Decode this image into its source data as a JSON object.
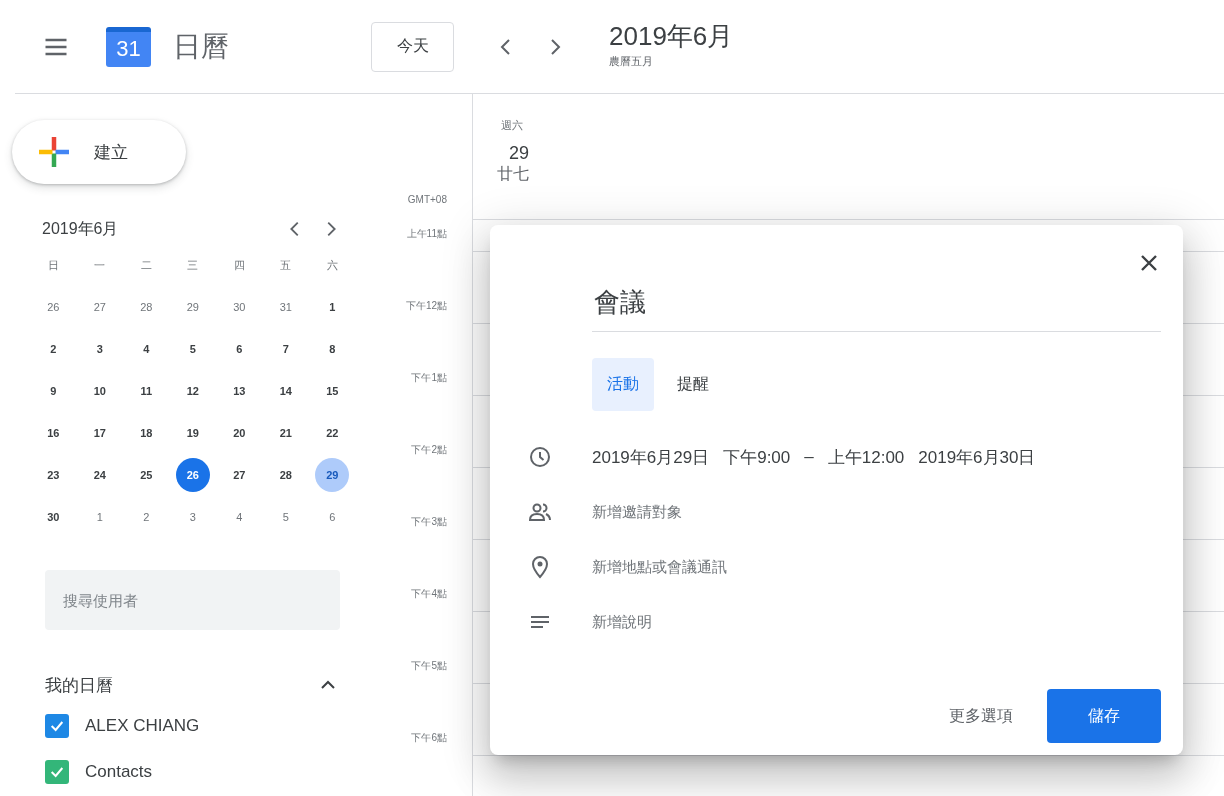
{
  "header": {
    "app_name": "日曆",
    "logo_day": "31",
    "today_button": "今天",
    "title": "2019年6月",
    "subtitle": "農曆五月"
  },
  "sidebar": {
    "create_button": "建立",
    "mini_calendar": {
      "title": "2019年6月",
      "weekdays": [
        "日",
        "一",
        "二",
        "三",
        "四",
        "五",
        "六"
      ],
      "weeks": [
        {
          "days": [
            {
              "day": "26",
              "in_month": false,
              "today": false,
              "selected": false
            },
            {
              "day": "27",
              "in_month": false,
              "today": false,
              "selected": false
            },
            {
              "day": "28",
              "in_month": false,
              "today": false,
              "selected": false
            },
            {
              "day": "29",
              "in_month": false,
              "today": false,
              "selected": false
            },
            {
              "day": "30",
              "in_month": false,
              "today": false,
              "selected": false
            },
            {
              "day": "31",
              "in_month": false,
              "today": false,
              "selected": false
            },
            {
              "day": "1",
              "in_month": true,
              "today": false,
              "selected": false
            }
          ]
        },
        {
          "days": [
            {
              "day": "2",
              "in_month": true,
              "today": false,
              "selected": false
            },
            {
              "day": "3",
              "in_month": true,
              "today": false,
              "selected": false
            },
            {
              "day": "4",
              "in_month": true,
              "today": false,
              "selected": false
            },
            {
              "day": "5",
              "in_month": true,
              "today": false,
              "selected": false
            },
            {
              "day": "6",
              "in_month": true,
              "today": false,
              "selected": false
            },
            {
              "day": "7",
              "in_month": true,
              "today": false,
              "selected": false
            },
            {
              "day": "8",
              "in_month": true,
              "today": false,
              "selected": false
            }
          ]
        },
        {
          "days": [
            {
              "day": "9",
              "in_month": true,
              "today": false,
              "selected": false
            },
            {
              "day": "10",
              "in_month": true,
              "today": false,
              "selected": false
            },
            {
              "day": "11",
              "in_month": true,
              "today": false,
              "selected": false
            },
            {
              "day": "12",
              "in_month": true,
              "today": false,
              "selected": false
            },
            {
              "day": "13",
              "in_month": true,
              "today": false,
              "selected": false
            },
            {
              "day": "14",
              "in_month": true,
              "today": false,
              "selected": false
            },
            {
              "day": "15",
              "in_month": true,
              "today": false,
              "selected": false
            }
          ]
        },
        {
          "days": [
            {
              "day": "16",
              "in_month": true,
              "today": false,
              "selected": false
            },
            {
              "day": "17",
              "in_month": true,
              "today": false,
              "selected": false
            },
            {
              "day": "18",
              "in_month": true,
              "today": false,
              "selected": false
            },
            {
              "day": "19",
              "in_month": true,
              "today": false,
              "selected": false
            },
            {
              "day": "20",
              "in_month": true,
              "today": false,
              "selected": false
            },
            {
              "day": "21",
              "in_month": true,
              "today": false,
              "selected": false
            },
            {
              "day": "22",
              "in_month": true,
              "today": false,
              "selected": false
            }
          ]
        },
        {
          "days": [
            {
              "day": "23",
              "in_month": true,
              "today": false,
              "selected": false
            },
            {
              "day": "24",
              "in_month": true,
              "today": false,
              "selected": false
            },
            {
              "day": "25",
              "in_month": true,
              "today": false,
              "selected": false
            },
            {
              "day": "26",
              "in_month": true,
              "today": true,
              "selected": false
            },
            {
              "day": "27",
              "in_month": true,
              "today": false,
              "selected": false
            },
            {
              "day": "28",
              "in_month": true,
              "today": false,
              "selected": false
            },
            {
              "day": "29",
              "in_month": true,
              "today": false,
              "selected": true
            }
          ]
        },
        {
          "days": [
            {
              "day": "30",
              "in_month": true,
              "today": false,
              "selected": false
            },
            {
              "day": "1",
              "in_month": false,
              "today": false,
              "selected": false
            },
            {
              "day": "2",
              "in_month": false,
              "today": false,
              "selected": false
            },
            {
              "day": "3",
              "in_month": false,
              "today": false,
              "selected": false
            },
            {
              "day": "4",
              "in_month": false,
              "today": false,
              "selected": false
            },
            {
              "day": "5",
              "in_month": false,
              "today": false,
              "selected": false
            },
            {
              "day": "6",
              "in_month": false,
              "today": false,
              "selected": false
            }
          ]
        }
      ]
    },
    "search": {
      "placeholder": "搜尋使用者"
    },
    "my_calendars": {
      "title": "我的日曆",
      "expanded": true,
      "items": [
        {
          "name": "ALEX CHIANG",
          "checked": true,
          "color": "#1e88e5"
        },
        {
          "name": "Contacts",
          "checked": true,
          "color": "#33b679"
        }
      ]
    }
  },
  "day_view": {
    "weekday": "週六",
    "date": "29",
    "lunar_date": "廿七",
    "timezone": "GMT+08",
    "hours": [
      "上午11點",
      "下午12點",
      "下午1點",
      "下午2點",
      "下午3點",
      "下午4點",
      "下午5點",
      "下午6點"
    ]
  },
  "event_dialog": {
    "title_value": "會議",
    "tabs": [
      {
        "label": "活動",
        "selected": true
      },
      {
        "label": "提醒",
        "selected": false
      }
    ],
    "rows": [
      {
        "kind": "time",
        "start_date": "2019年6月29日",
        "start_time": "下午9:00",
        "separator": "–",
        "end_time": "上午12:00",
        "end_date": "2019年6月30日"
      },
      {
        "kind": "guests",
        "text": "新增邀請對象"
      },
      {
        "kind": "location",
        "text": "新增地點或會議通訊"
      },
      {
        "kind": "description",
        "text": "新增說明"
      }
    ],
    "more_options_button": "更多選項",
    "save_button": "儲存"
  }
}
